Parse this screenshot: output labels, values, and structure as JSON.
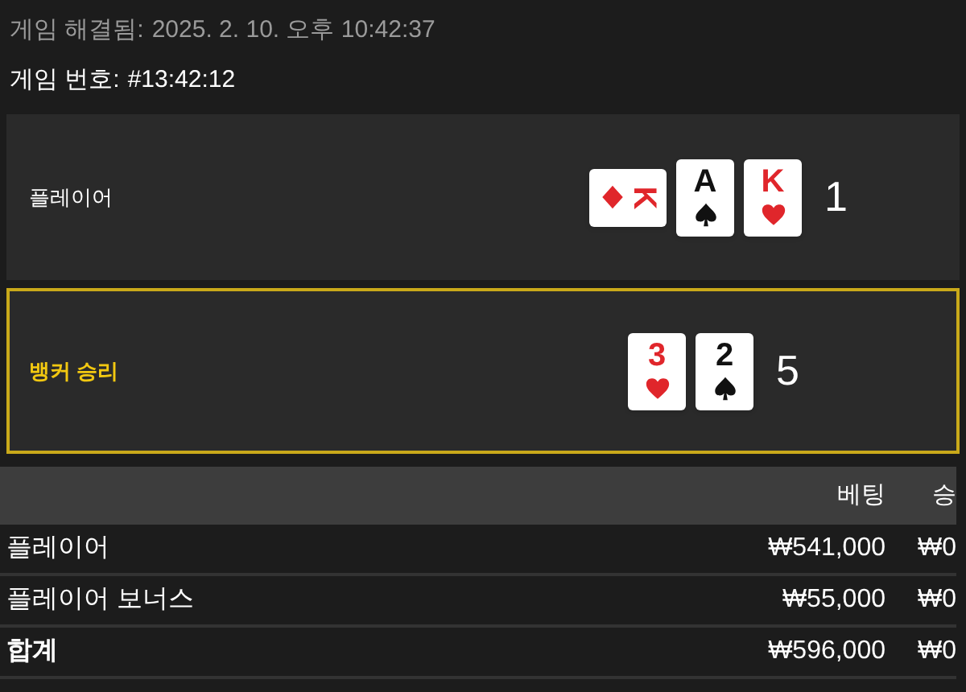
{
  "header": {
    "resolved_label": "게임 해결됨:",
    "resolved_value": "2025. 2. 10. 오후 10:42:37",
    "game_label": "게임 번호:",
    "game_value": "#13:42:12"
  },
  "hands": [
    {
      "name": "플레이어",
      "winner": false,
      "score": "1",
      "cards": [
        {
          "rank": "K",
          "kind": "diamond",
          "rotated": true
        },
        {
          "rank": "A",
          "kind": "spade",
          "rotated": false
        },
        {
          "rank": "K",
          "kind": "heart",
          "rotated": false
        }
      ]
    },
    {
      "name": "뱅커 승리",
      "winner": true,
      "score": "5",
      "cards": [
        {
          "rank": "3",
          "kind": "heart",
          "rotated": false
        },
        {
          "rank": "2",
          "kind": "spade",
          "rotated": false
        }
      ]
    }
  ],
  "table": {
    "columns": [
      "베팅",
      "승"
    ],
    "rows": [
      {
        "kind": "bet",
        "label": "플레이어",
        "bet": "₩541,000",
        "win": "₩0"
      },
      {
        "kind": "bet",
        "label": "플레이어 보너스",
        "bet": "₩55,000",
        "win": "₩0"
      },
      {
        "kind": "total",
        "label": "합계",
        "bet": "₩596,000",
        "win": "₩0"
      }
    ]
  }
}
